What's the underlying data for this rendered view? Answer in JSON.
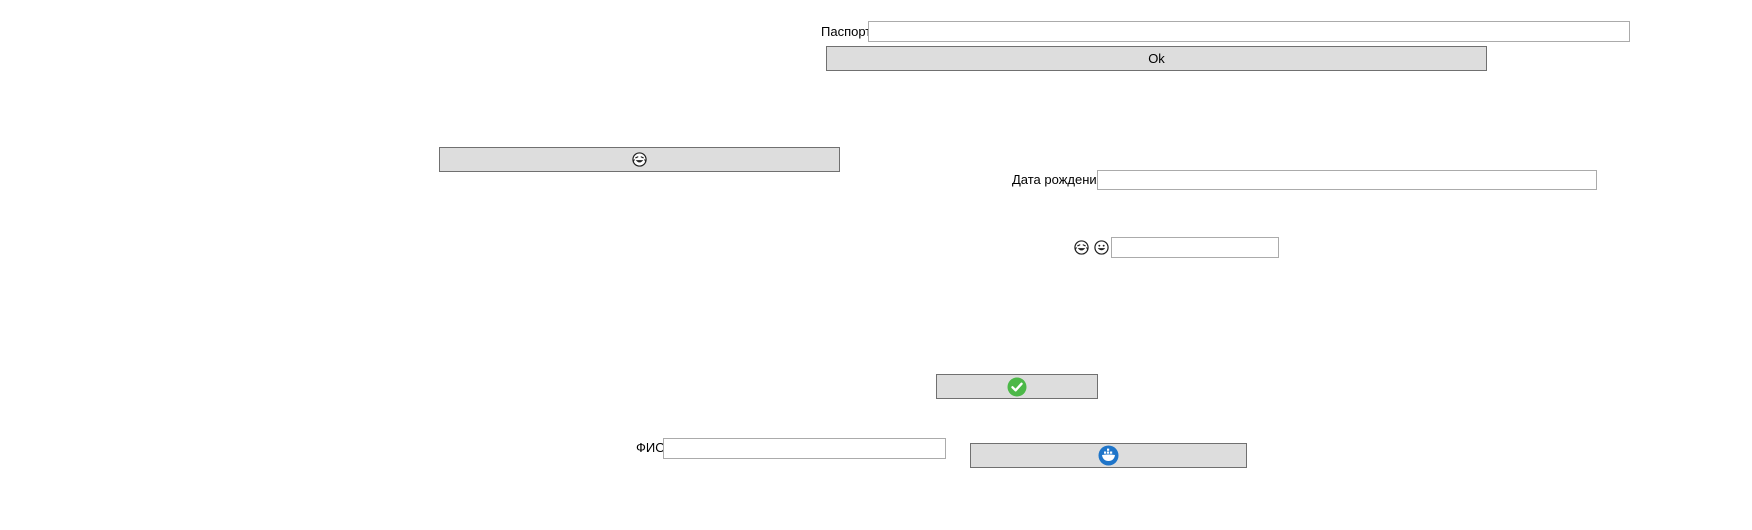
{
  "passport": {
    "label": "Паспорт",
    "value": ""
  },
  "ok_button": {
    "label": "Ok"
  },
  "laugh_button": {
    "icon": "laughing-face-icon"
  },
  "birth_date": {
    "label": "Дата рождения",
    "value": ""
  },
  "emoji_field": {
    "icons": [
      "laughing-face-icon",
      "grinning-face-icon"
    ],
    "value": ""
  },
  "confirm_button": {
    "icon": "checkmark-icon",
    "icon_color": "#4cb848"
  },
  "fio": {
    "label": "ФИО",
    "value": ""
  },
  "docker_button": {
    "icon": "blue-whale-badge-icon",
    "icon_color": "#1f75c9"
  }
}
